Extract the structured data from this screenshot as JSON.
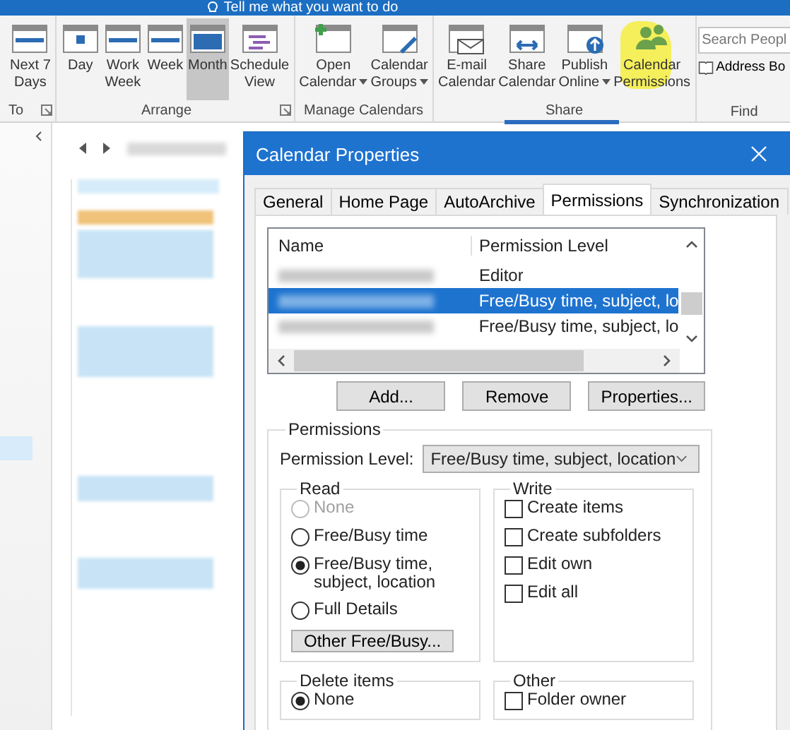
{
  "search_bar": {
    "text": "Tell me what you want to do"
  },
  "ribbon": {
    "groups": [
      {
        "label": "To",
        "launcher": true,
        "buttons": [
          {
            "kind": "nextdays",
            "lines": [
              "Next 7",
              "Days"
            ],
            "selected": false,
            "dropdown": false,
            "highlighted": false
          }
        ]
      },
      {
        "label": "Arrange",
        "launcher": true,
        "buttons": [
          {
            "kind": "day",
            "lines": [
              "Day"
            ],
            "selected": false,
            "dropdown": false,
            "highlighted": false
          },
          {
            "kind": "workweek",
            "lines": [
              "Work",
              "Week"
            ],
            "selected": false,
            "dropdown": false,
            "highlighted": false
          },
          {
            "kind": "week",
            "lines": [
              "Week"
            ],
            "selected": false,
            "dropdown": false,
            "highlighted": false
          },
          {
            "kind": "month",
            "lines": [
              "Month"
            ],
            "selected": true,
            "dropdown": false,
            "highlighted": false
          },
          {
            "kind": "schedule",
            "lines": [
              "Schedule",
              "View"
            ],
            "selected": false,
            "dropdown": false,
            "highlighted": false
          }
        ]
      },
      {
        "label": "Manage Calendars",
        "launcher": false,
        "buttons": [
          {
            "kind": "open",
            "lines": [
              "Open",
              "Calendar"
            ],
            "selected": false,
            "dropdown": true,
            "highlighted": false
          },
          {
            "kind": "groups",
            "lines": [
              "Calendar",
              "Groups"
            ],
            "selected": false,
            "dropdown": true,
            "highlighted": false
          }
        ]
      },
      {
        "label": "Share",
        "launcher": false,
        "buttons": [
          {
            "kind": "email",
            "lines": [
              "E-mail",
              "Calendar"
            ],
            "selected": false,
            "dropdown": false,
            "highlighted": false
          },
          {
            "kind": "share",
            "lines": [
              "Share",
              "Calendar"
            ],
            "selected": false,
            "dropdown": false,
            "highlighted": false
          },
          {
            "kind": "publish",
            "lines": [
              "Publish",
              "Online"
            ],
            "selected": false,
            "dropdown": true,
            "highlighted": false
          },
          {
            "kind": "people",
            "lines": [
              "Calendar",
              "Permissions"
            ],
            "selected": false,
            "dropdown": false,
            "highlighted": true
          }
        ]
      }
    ],
    "find": {
      "label": "Find",
      "search_placeholder": "Search Peopl",
      "address_book": "Address Bo"
    }
  },
  "dialog": {
    "title": "Calendar Properties",
    "tabs": [
      {
        "label": "General",
        "selected": false
      },
      {
        "label": "Home Page",
        "selected": false
      },
      {
        "label": "AutoArchive",
        "selected": false
      },
      {
        "label": "Permissions",
        "selected": true
      },
      {
        "label": "Synchronization",
        "selected": false
      }
    ],
    "permission_table": {
      "columns": [
        "Name",
        "Permission Level"
      ],
      "rows": [
        {
          "level": "Editor",
          "selected": false
        },
        {
          "level": "Free/Busy time, subject, lo",
          "selected": true
        },
        {
          "level": "Free/Busy time, subject, lo",
          "selected": false
        }
      ]
    },
    "list_buttons": [
      "Add...",
      "Remove",
      "Properties..."
    ],
    "permissions": {
      "label": "Permissions",
      "level_label": "Permission Level:",
      "level_value": "Free/Busy time, subject, location",
      "read": {
        "label": "Read",
        "options": [
          {
            "label": "None",
            "selected": false,
            "disabled": true
          },
          {
            "label": "Free/Busy time",
            "selected": false,
            "disabled": false
          },
          {
            "label": "Free/Busy time, subject, location",
            "selected": true,
            "disabled": false
          },
          {
            "label": "Full Details",
            "selected": false,
            "disabled": false
          }
        ],
        "button": "Other Free/Busy..."
      },
      "write": {
        "label": "Write",
        "options": [
          {
            "label": "Create items",
            "checked": false
          },
          {
            "label": "Create subfolders",
            "checked": false
          },
          {
            "label": "Edit own",
            "checked": false
          },
          {
            "label": "Edit all",
            "checked": false
          }
        ]
      },
      "delete_items": {
        "label": "Delete items",
        "options": [
          {
            "label": "None",
            "selected": true,
            "disabled": false
          }
        ]
      },
      "other": {
        "label": "Other",
        "options": [
          {
            "label": "Folder owner",
            "checked": false
          }
        ]
      }
    }
  }
}
